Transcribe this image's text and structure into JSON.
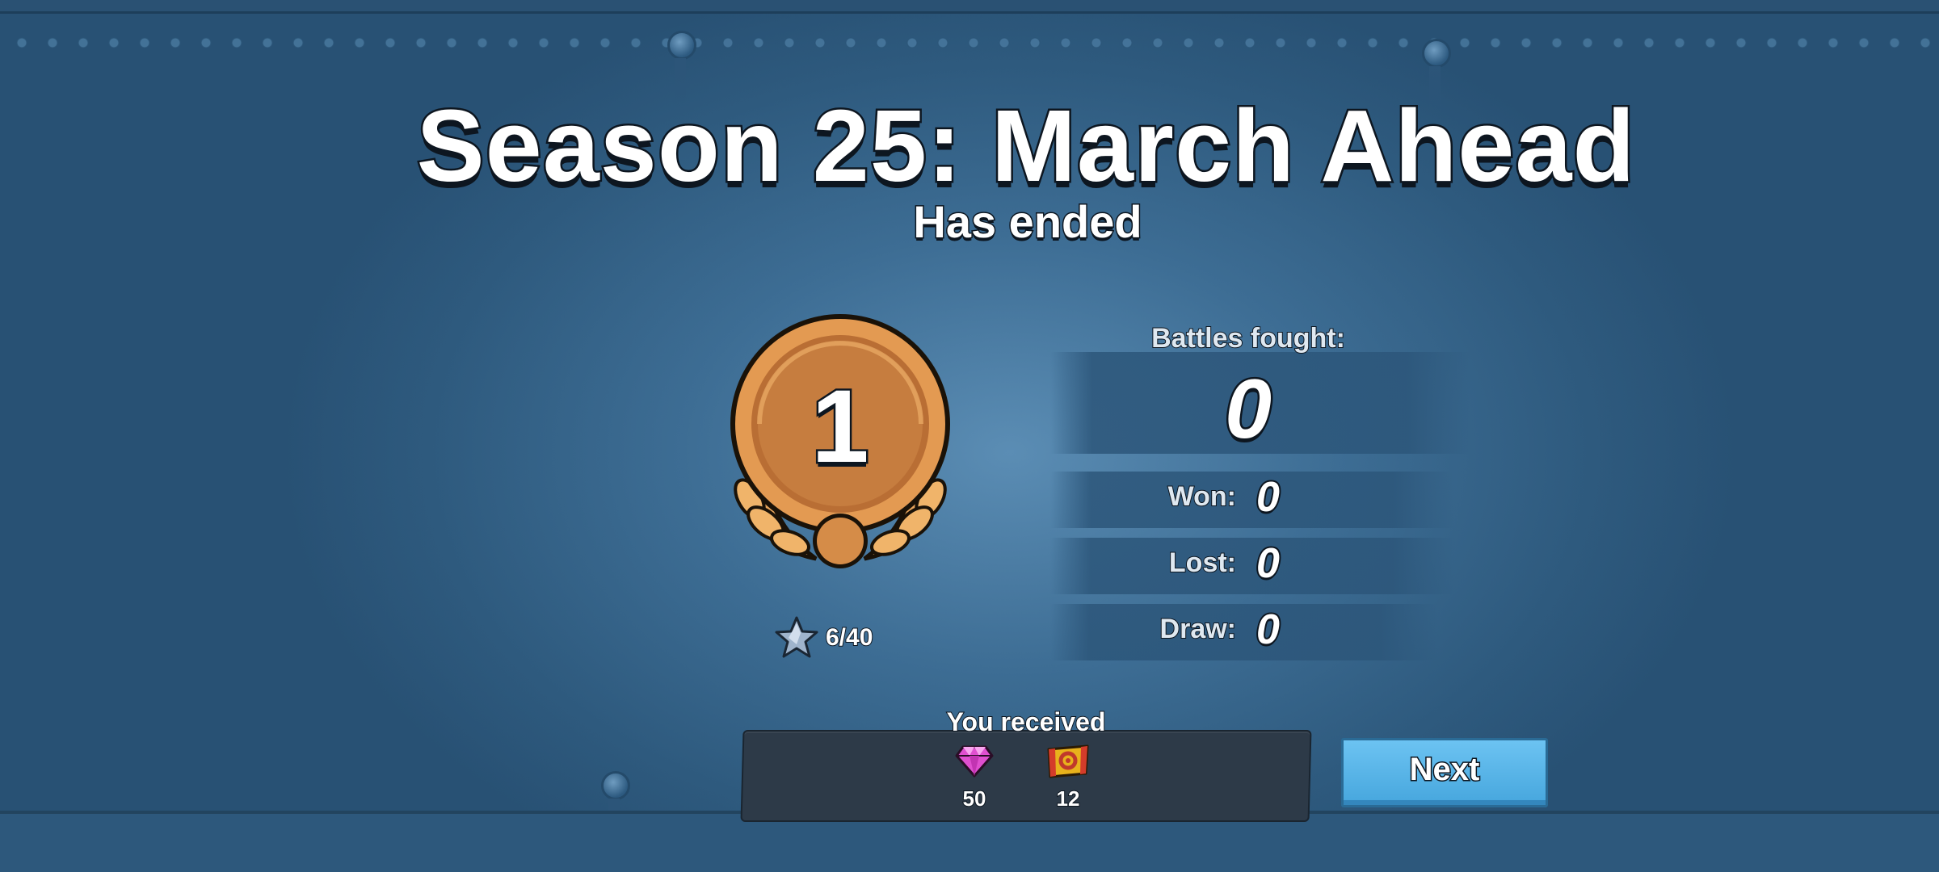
{
  "header": {
    "title": "Season 25: March Ahead",
    "subtitle": "Has ended"
  },
  "rank": {
    "number": "1",
    "tier_color": "#c9803f",
    "stars_text": "6/40",
    "star_icon": "star-icon"
  },
  "stats": {
    "battles_label": "Battles fought:",
    "battles_value": "0",
    "won_label": "Won:",
    "won_value": "0",
    "lost_label": "Lost:",
    "lost_value": "0",
    "draw_label": "Draw:",
    "draw_value": "0"
  },
  "rewards": {
    "label": "You received",
    "items": [
      {
        "icon": "gem-icon",
        "count": "50",
        "color": "#e04fd0"
      },
      {
        "icon": "gear-card-icon",
        "count": "12",
        "color": "#e8b21c"
      }
    ]
  },
  "actions": {
    "next_label": "Next",
    "button_color": "#5bb6ea"
  }
}
